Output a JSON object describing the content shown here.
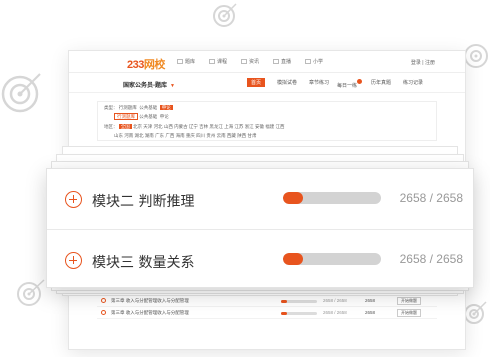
{
  "mock": {
    "logo_main": "233",
    "logo_sub": "网校",
    "top_nav": [
      "题库",
      "课程",
      "资讯",
      "直播",
      "小学"
    ],
    "top_right": "登录 | 注册",
    "exam_name": "国家公务员-题库",
    "sub_nav": [
      "首页",
      "模拟试卷",
      "章节练习",
      "每日一练",
      "历年真题",
      "练习记录"
    ],
    "filter_row1": [
      "类型：",
      "行测题库",
      "公共基础",
      "申论"
    ],
    "filter_row2": [
      "行测题库",
      "公共基础",
      "申论"
    ],
    "filter_row3": [
      "地区：",
      "全国",
      "北京",
      "天津",
      "河北",
      "山西",
      "内蒙古",
      "辽宁",
      "吉林",
      "黑龙江",
      "上海",
      "江苏",
      "浙江",
      "安徽",
      "福建",
      "江西"
    ],
    "filter_row4": [
      "山东",
      "河南",
      "湖北",
      "湖南",
      "广东",
      "广西",
      "海南",
      "重庆",
      "四川",
      "贵州",
      "云南",
      "西藏",
      "陕西",
      "甘肃"
    ],
    "rows": [
      {
        "title": "第三章  收入与分配管理收入与分配管理",
        "count": "2658 / 2658",
        "total": "2658",
        "btn": "开始做题"
      },
      {
        "title": "第三章  收入与分配管理收入与分配管理",
        "count": "2658 / 2658",
        "total": "2658",
        "btn": "开始做题"
      },
      {
        "title": "第三章  收入与分配管理收入与分配管理",
        "count": "2658 / 2658",
        "total": "2658",
        "btn": "开始做题"
      }
    ]
  },
  "modules": [
    {
      "title": "模块二  判断推理",
      "progress": 0.2,
      "count": "2658 / 2658"
    },
    {
      "title": "模块三  数量关系",
      "progress": 0.2,
      "count": "2658 / 2658"
    }
  ],
  "colors": {
    "accent": "#e8541e",
    "track": "#d3d3d3",
    "target": "#d6d6d6"
  },
  "icons": [
    "target-icon",
    "plus-circle-icon",
    "chevron-down-icon",
    "book-icon",
    "play-icon"
  ]
}
